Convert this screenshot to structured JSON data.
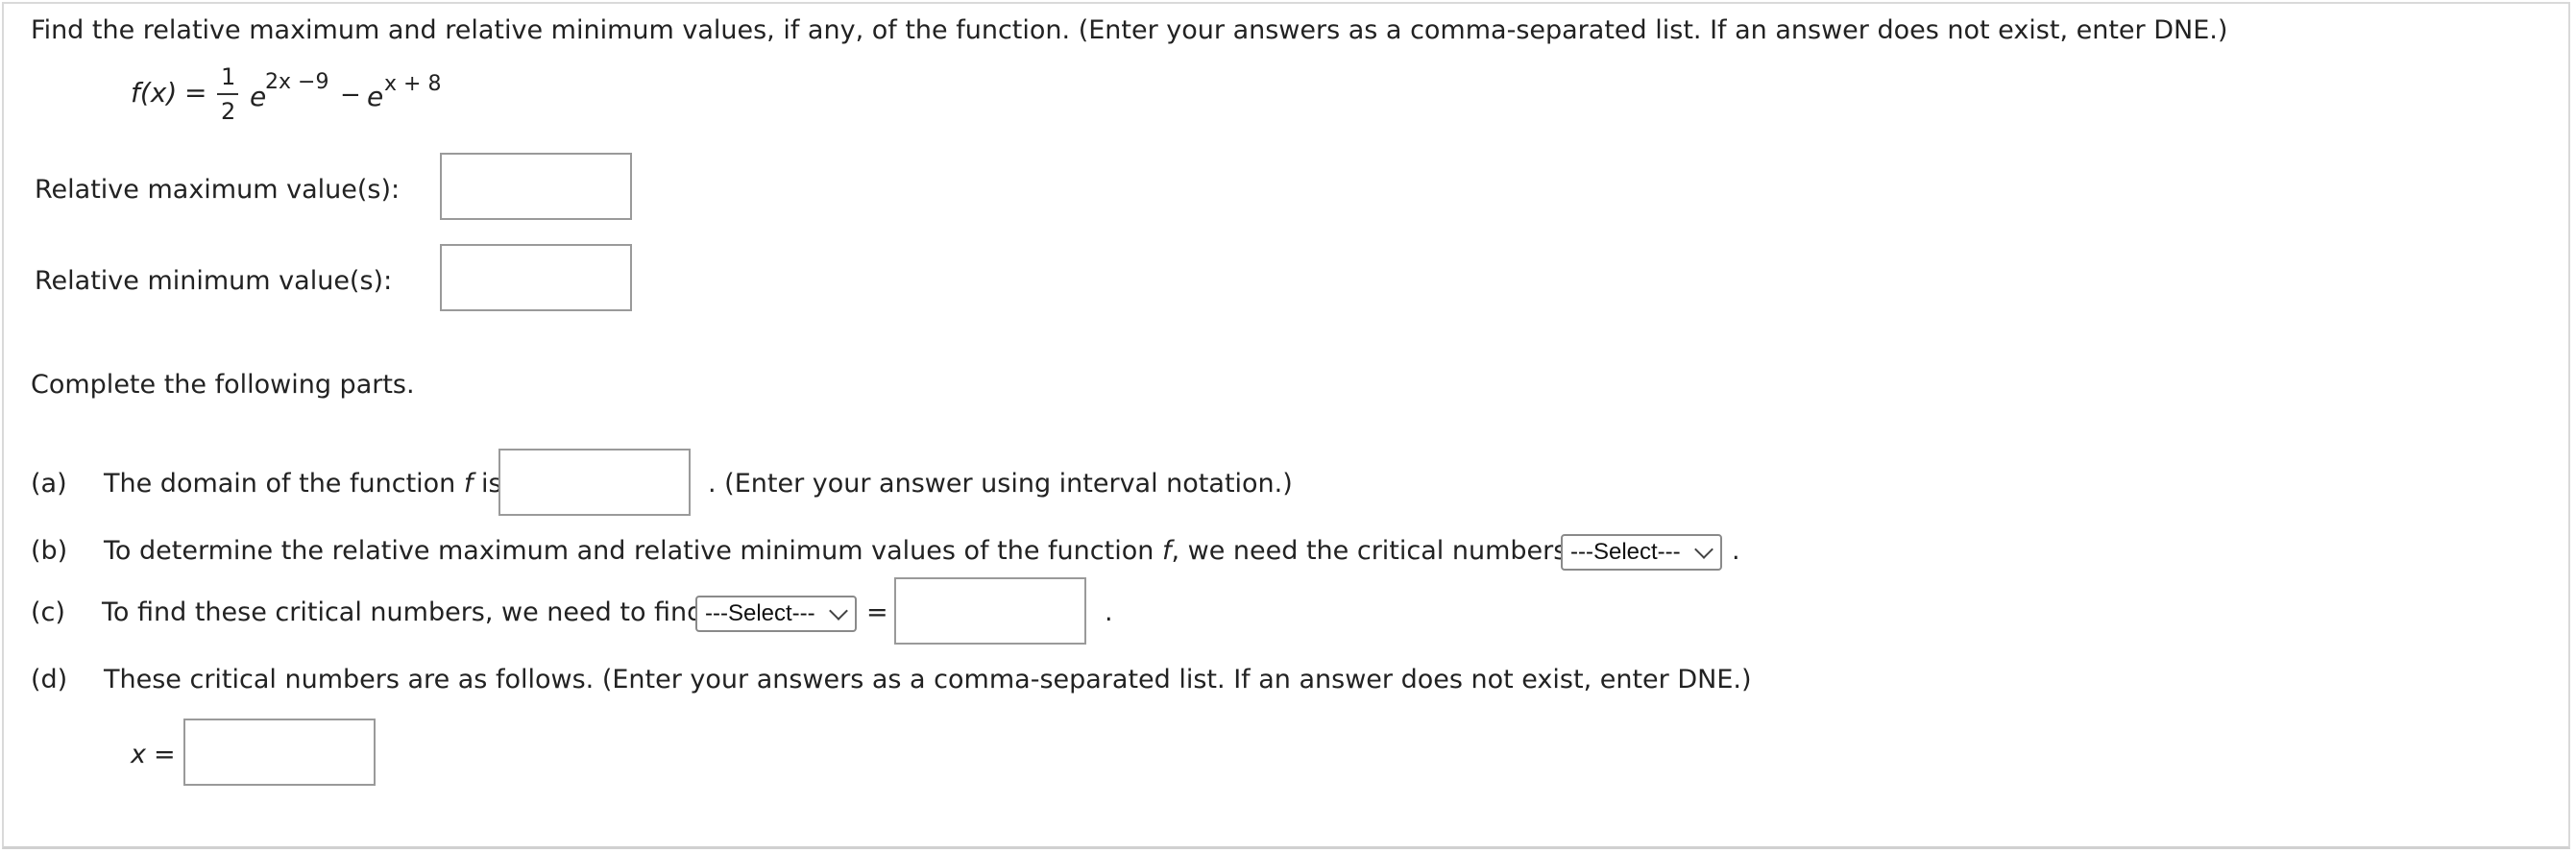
{
  "intro": "Find the relative maximum and relative minimum values, if any, of the function. (Enter your answers as a comma-separated list. If an answer does not exist, enter DNE.)",
  "function": {
    "lhs": "f(x)",
    "equals": "=",
    "numerator": "1",
    "denominator": "2",
    "base1": "e",
    "exp1": "2x −9",
    "minus": "−",
    "base2": "e",
    "exp2": "x + 8"
  },
  "rel_max": {
    "label": "Relative maximum value(s):",
    "value": ""
  },
  "rel_min": {
    "label": "Relative minimum value(s):",
    "value": ""
  },
  "complete_text": "Complete the following parts.",
  "part_a": {
    "letter": "(a)",
    "text_before": "The domain of the function",
    "fname": "f",
    "text_is": "is",
    "value": "",
    "text_after": ". (Enter your answer using interval notation.)"
  },
  "part_b": {
    "letter": "(b)",
    "text_before": "To determine the relative maximum and relative minimum values of the function",
    "fname": "f",
    "text_after": ", we need the critical numbers of",
    "select_value": "---Select---",
    "period": "."
  },
  "part_c": {
    "letter": "(c)",
    "text_before": "To find these critical numbers, we need to find",
    "select_value": "---Select---",
    "equals": "=",
    "value": "",
    "period": "."
  },
  "part_d": {
    "letter": "(d)",
    "text": "These critical numbers are as follows. (Enter your answers as a comma-separated list. If an answer does not exist, enter DNE.)",
    "x_label": "x",
    "equals": "=",
    "value": ""
  }
}
